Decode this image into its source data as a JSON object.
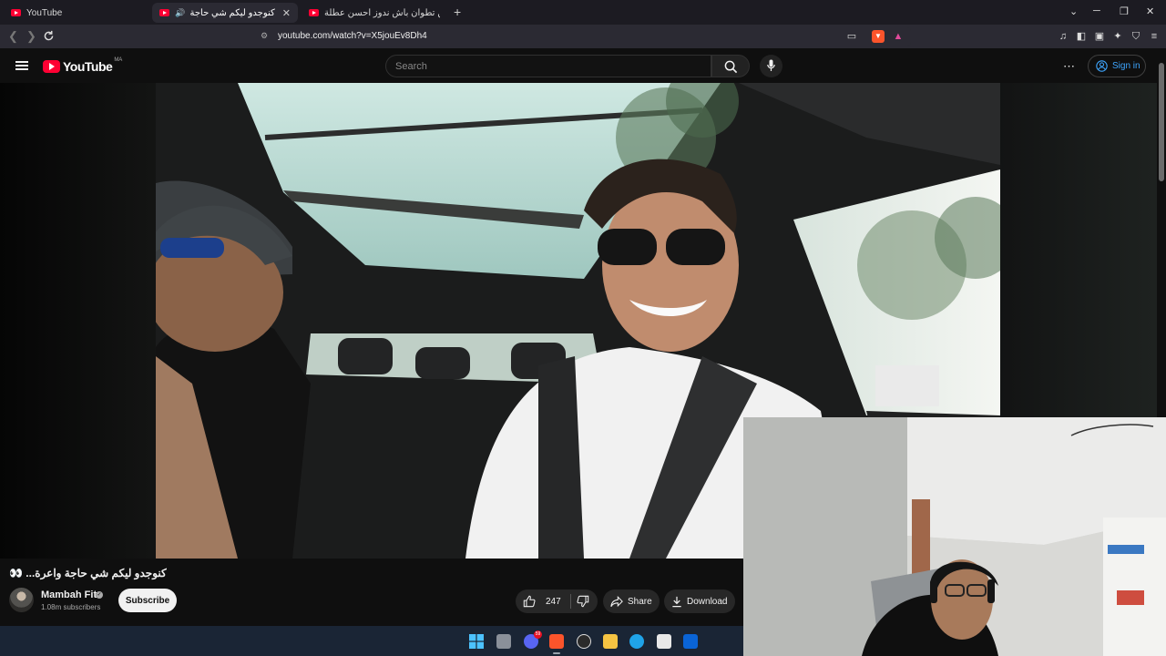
{
  "browser": {
    "tabs": [
      {
        "title": "YouTube",
        "active": false
      },
      {
        "title": "كنوجدو ليكم شي حاجة واعرة...",
        "active": true,
        "audio": true
      },
      {
        "title": "سافرت من تطوان باش ندوز أحسن عطلة",
        "active": false
      }
    ],
    "url": "youtube.com/watch?v=X5jouEv8Dh4"
  },
  "youtube": {
    "logo_text": "YouTube",
    "country_code": "MA",
    "search_placeholder": "Search",
    "signin_label": "Sign in"
  },
  "video": {
    "title": "كنوجدو ليكم شي حاجة واعرة... 👀",
    "channel": "Mambah Fit",
    "subscribers": "1.08m subscribers",
    "subscribe_label": "Subscribe",
    "likes": "247",
    "share_label": "Share",
    "download_label": "Download"
  },
  "taskbar": {
    "discord_badge": "59"
  },
  "colors": {
    "youtube_red": "#ff0033",
    "link_blue": "#3ea6ff",
    "background": "#0f0f0f"
  }
}
